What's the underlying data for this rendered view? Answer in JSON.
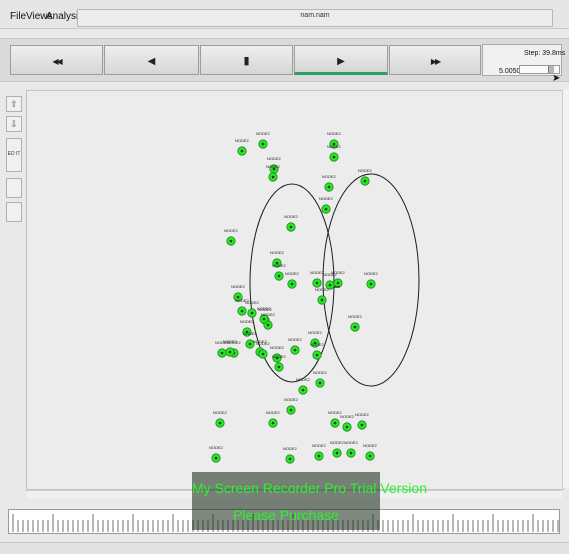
{
  "menu": {
    "file_label": "File",
    "views_label": "Views",
    "analysis_label": "Analysis"
  },
  "title": "nam.nam",
  "playback": {
    "rewind_label": "◀◀",
    "back_label": "◀",
    "stop_label": "▮",
    "play_label": "▶",
    "fast_forward_label": "▶▶",
    "active_button": "play"
  },
  "time_readout": "5.005011",
  "step_label": "Step: 39.8ms",
  "step_slider_level": 0.8,
  "tools": {
    "zoom_in_icon": "zoom-in-icon",
    "zoom_out_icon": "zoom-out-icon",
    "edit_label": "ED IT"
  },
  "node_label": "NODE2",
  "colors": {
    "node_fill": "#29e629",
    "node_stroke": "#1a8a1a",
    "range_circle": "#1d1d1d",
    "active_underline": "#2aa167",
    "watermark_text": "#27f52b"
  },
  "watermark": {
    "line1": "My Screen Recorder Pro Trial Version",
    "line2": "Please Purchase"
  }
}
